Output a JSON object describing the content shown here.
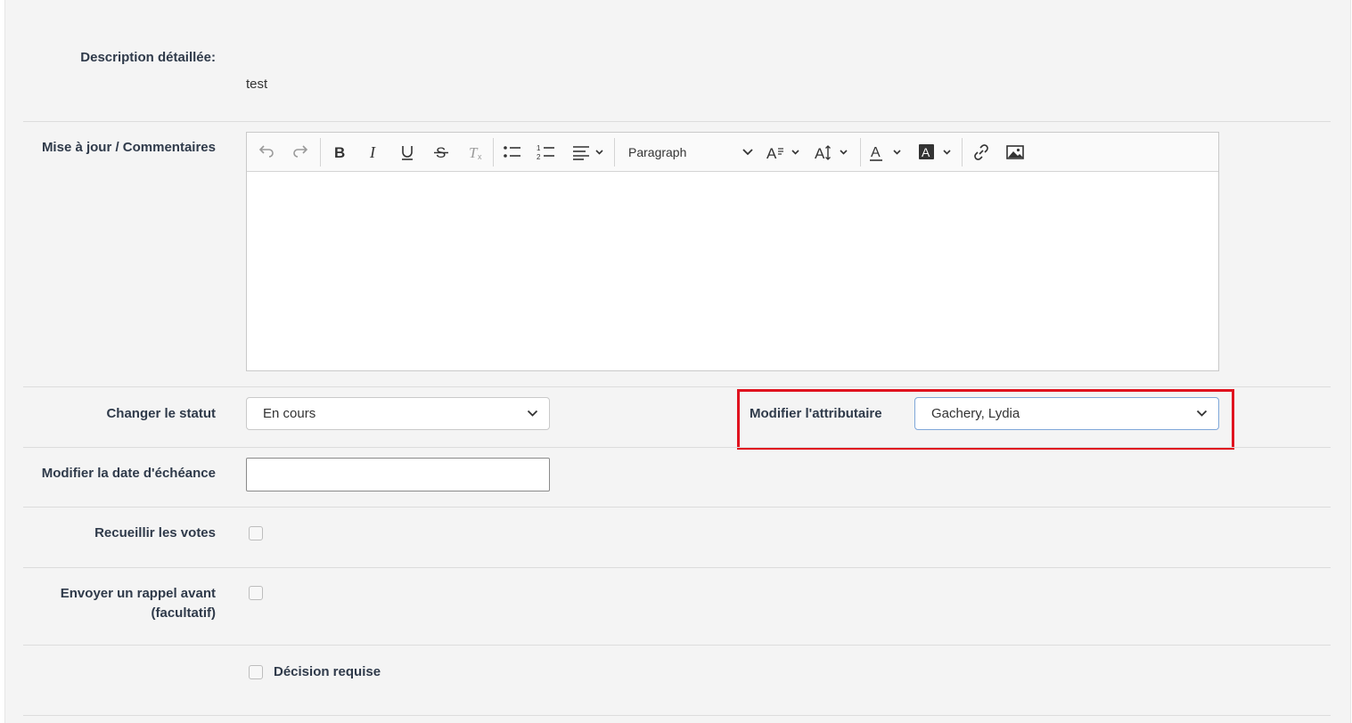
{
  "form": {
    "description": {
      "label": "Description détaillée:",
      "value": "test"
    },
    "comments": {
      "label": "Mise à jour / Commentaires",
      "toolbar": {
        "undo_icon": "undo-icon",
        "redo_icon": "redo-icon",
        "bold_icon": "bold-icon",
        "italic_icon": "italic-icon",
        "underline_icon": "underline-icon",
        "strikethrough_icon": "strikethrough-icon",
        "clear_format_icon": "remove-format-icon",
        "bullet_list_icon": "bulleted-list-icon",
        "numbered_list_icon": "numbered-list-icon",
        "align_icon": "text-align-icon",
        "heading_value": "Paragraph",
        "font_family_icon": "font-family-icon",
        "font_size_icon": "font-size-icon",
        "font_color_icon": "font-color-icon",
        "background_color_icon": "font-background-color-icon",
        "link_icon": "link-icon",
        "image_icon": "image-icon"
      },
      "content": ""
    },
    "status": {
      "label": "Changer le statut",
      "value": "En cours"
    },
    "assignee": {
      "label": "Modifier l'attributaire",
      "value": "Gachery, Lydia"
    },
    "due_date": {
      "label": "Modifier la date d'échéance",
      "value": ""
    },
    "votes": {
      "label": "Recueillir les votes",
      "checked": false
    },
    "reminder": {
      "label_line1": "Envoyer un rappel avant",
      "label_line2": "(facultatif)",
      "checked": false
    },
    "decision": {
      "label": "Décision requise",
      "checked": false
    }
  },
  "colors": {
    "highlight": "#e0131f",
    "label": "#2f3a4a",
    "panel": "#f4f4f4"
  }
}
